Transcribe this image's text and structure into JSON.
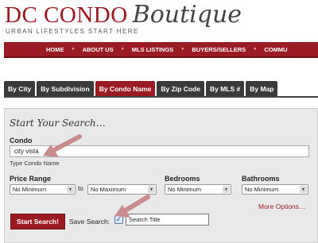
{
  "brand": {
    "name": "DC CONDO",
    "script": "Boutique",
    "tagline": "URBAN LIFESTYLES START HERE"
  },
  "nav": {
    "items": [
      "HOME",
      "ABOUT US",
      "MLS LISTINGS",
      "BUYERS/SELLERS",
      "COMMU"
    ]
  },
  "tabs": [
    {
      "label": "By City",
      "active": false
    },
    {
      "label": "By Subdivision",
      "active": false
    },
    {
      "label": "By Condo Name",
      "active": true
    },
    {
      "label": "By Zip Code",
      "active": false
    },
    {
      "label": "By MLS #",
      "active": false
    },
    {
      "label": "By Map",
      "active": false
    }
  ],
  "search": {
    "title": "Start Your Search…",
    "condo_label": "Condo",
    "condo_value": "city vista",
    "condo_hint": "Type Condo Name",
    "price_label": "Price Range",
    "price_min": "No Minimum",
    "price_to": "to",
    "price_max": "No Maximum",
    "bedrooms_label": "Bedrooms",
    "bedrooms_value": "No Minimum",
    "bathrooms_label": "Bathrooms",
    "bathrooms_value": "No Minimum",
    "more_options": "More Options…",
    "start_button": "Start Search!",
    "save_label": "Save Search:",
    "save_checked": true,
    "save_title_value": "Search Title"
  },
  "colors": {
    "brand_red": "#9b1b23",
    "tab_dark": "#3a3a3a",
    "annotation_arrow": "#c98c8f"
  }
}
